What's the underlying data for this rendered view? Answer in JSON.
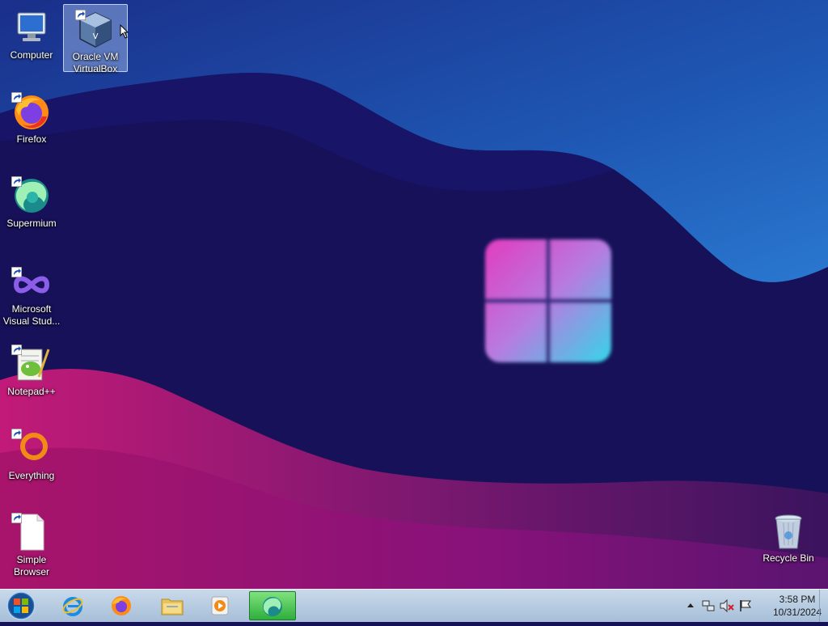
{
  "desktop": {
    "icons": [
      {
        "label": "Computer",
        "icon": "computer-icon",
        "selected": false
      },
      {
        "label": "Oracle VM\nVirtualBox",
        "icon": "virtualbox-icon",
        "selected": true
      },
      {
        "label": "Firefox",
        "icon": "firefox-icon",
        "selected": false
      },
      {
        "label": "Supermium",
        "icon": "supermium-icon",
        "selected": false
      },
      {
        "label": "Microsoft\nVisual Stud...",
        "icon": "visual-studio-icon",
        "selected": false
      },
      {
        "label": "Notepad++",
        "icon": "notepadpp-icon",
        "selected": false
      },
      {
        "label": "Everything",
        "icon": "everything-icon",
        "selected": false
      },
      {
        "label": "Simple\nBrowser",
        "icon": "document-icon",
        "selected": false
      },
      {
        "label": "Recycle Bin",
        "icon": "recycle-bin-icon",
        "selected": false
      }
    ]
  },
  "taskbar": {
    "start": {
      "icon": "windows-start-icon"
    },
    "pinned": [
      {
        "name": "internet-explorer",
        "icon": "internet-explorer-icon",
        "active": false
      },
      {
        "name": "firefox",
        "icon": "firefox-icon",
        "active": false
      },
      {
        "name": "file-explorer",
        "icon": "folder-icon",
        "active": false
      },
      {
        "name": "media-player",
        "icon": "media-player-icon",
        "active": false
      },
      {
        "name": "supermium",
        "icon": "supermium-icon",
        "active": true
      }
    ],
    "tray": {
      "icons": [
        "show-hidden-icons-arrow",
        "network-icon",
        "volume-muted-icon",
        "action-center-flag-icon"
      ],
      "time": "3:58 PM",
      "date": "10/31/2024"
    }
  },
  "colors": {
    "wallpaper_dark": "#161158",
    "wallpaper_blue": "#1f5fb8",
    "wallpaper_magenta": "#b0186e",
    "taskbar": "#b5cbe0",
    "active_task": "#3bbf4a"
  }
}
